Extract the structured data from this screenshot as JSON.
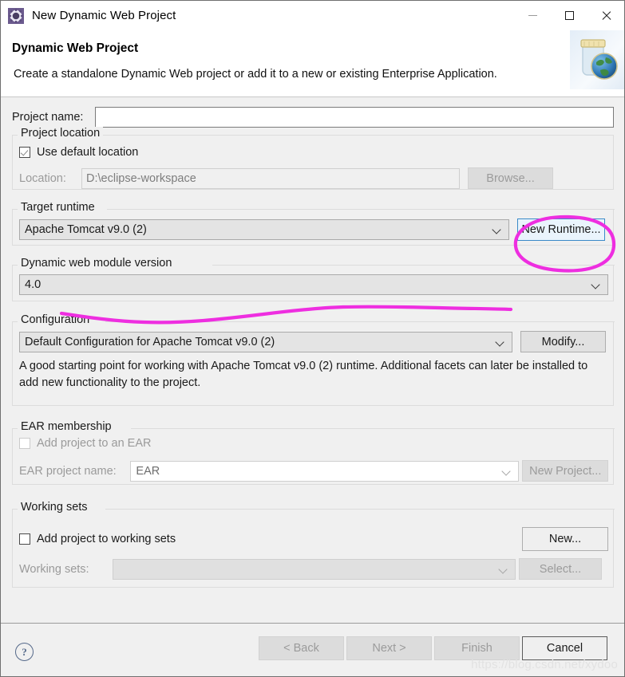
{
  "window": {
    "title": "New Dynamic Web Project",
    "icon": "eclipse-gear-icon",
    "minimize_label": "—",
    "maximize_label": "□",
    "close_label": "✕"
  },
  "banner": {
    "title": "Dynamic Web Project",
    "description": "Create a standalone Dynamic Web project or add it to a new or existing Enterprise Application.",
    "icon": "jar-globe-icon"
  },
  "project_name": {
    "label": "Project name:",
    "value": "",
    "placeholder": ""
  },
  "project_location": {
    "group_title": "Project location",
    "use_default_label": "Use default location",
    "use_default_checked": true,
    "location_label": "Location:",
    "location_value": "D:\\eclipse-workspace",
    "browse_label": "Browse..."
  },
  "target_runtime": {
    "group_title": "Target runtime",
    "value": "Apache Tomcat v9.0 (2)",
    "new_runtime_label": "New Runtime..."
  },
  "module_version": {
    "group_title": "Dynamic web module version",
    "value": "4.0"
  },
  "configuration": {
    "group_title": "Configuration",
    "value": "Default Configuration for Apache Tomcat v9.0 (2)",
    "modify_label": "Modify...",
    "description": "A good starting point for working with Apache Tomcat v9.0 (2) runtime. Additional facets can later be installed to add new functionality to the project."
  },
  "ear_membership": {
    "group_title": "EAR membership",
    "add_to_ear_label": "Add project to an EAR",
    "add_to_ear_checked": false,
    "ear_project_name_label": "EAR project name:",
    "ear_project_name_value": "EAR",
    "new_project_label": "New Project..."
  },
  "working_sets": {
    "group_title": "Working sets",
    "add_to_working_sets_label": "Add project to working sets",
    "add_to_working_sets_checked": false,
    "new_label": "New...",
    "working_sets_label": "Working sets:",
    "working_sets_value": "",
    "select_label": "Select..."
  },
  "footer": {
    "help_label": "?",
    "back_label": "< Back",
    "next_label": "Next >",
    "finish_label": "Finish",
    "cancel_label": "Cancel"
  },
  "watermark": {
    "text": "https://blog.csdn.net/xydoo"
  },
  "colors": {
    "annotation": "#ee2ee0",
    "highlight_button_border": "#3a8ac8",
    "highlight_button_fill": "#eaf4fc",
    "dialog_background": "#f0f0f0",
    "banner_background": "#ffffff"
  }
}
